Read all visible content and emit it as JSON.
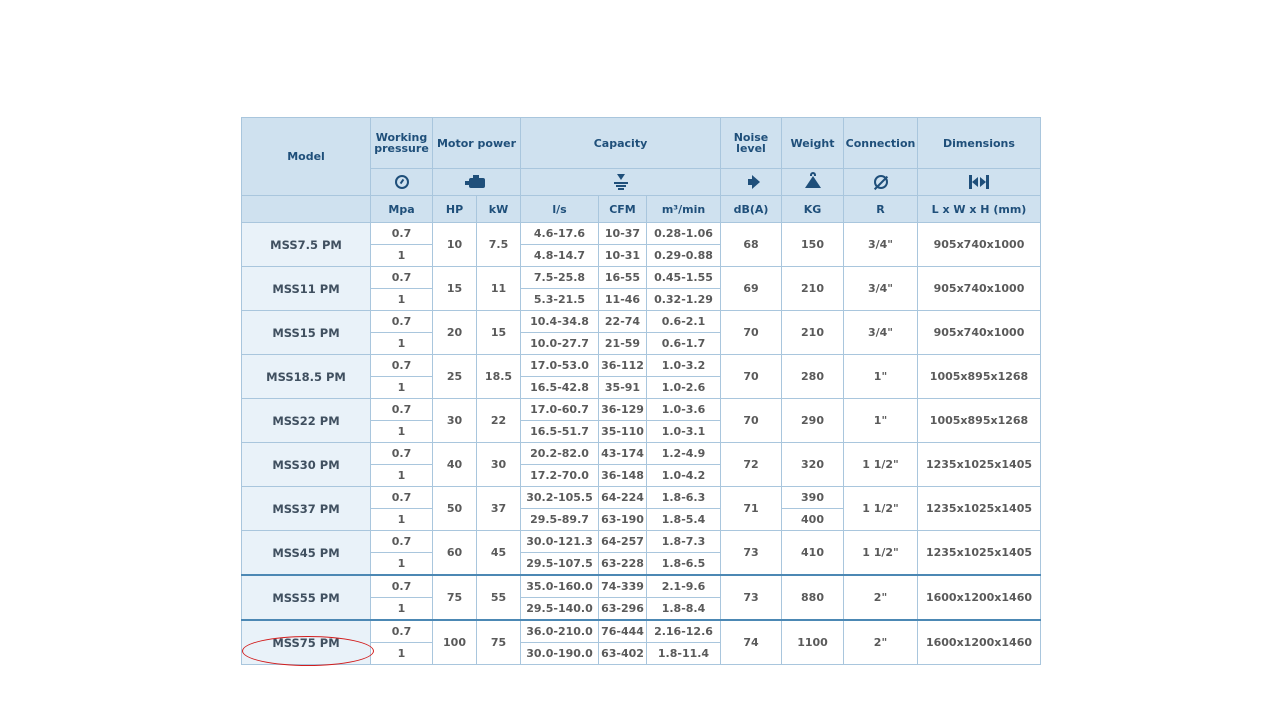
{
  "header": {
    "model": "Model",
    "working_pressure": "Working pressure",
    "motor_power": "Motor power",
    "capacity": "Capacity",
    "noise_level": "Noise level",
    "weight": "Weight",
    "connection": "Connection",
    "dimensions": "Dimensions",
    "units": {
      "pressure": "Mpa",
      "hp": "HP",
      "kw": "kW",
      "ls": "l/s",
      "cfm": "CFM",
      "m3min": "m³/min",
      "dba": "dB(A)",
      "kg": "KG",
      "r": "R",
      "dims": "L x W x H (mm)"
    }
  },
  "rows": [
    {
      "model": "MSS7.5 PM",
      "p1": "0.7",
      "p2": "1",
      "hp": "10",
      "kw": "7.5",
      "ls1": "4.6-17.6",
      "cfm1": "10-37",
      "m31": "0.28-1.06",
      "ls2": "4.8-14.7",
      "cfm2": "10-31",
      "m32": "0.29-0.88",
      "db": "68",
      "kg": "150",
      "r": "3/4\"",
      "dims": "905x740x1000"
    },
    {
      "model": "MSS11 PM",
      "p1": "0.7",
      "p2": "1",
      "hp": "15",
      "kw": "11",
      "ls1": "7.5-25.8",
      "cfm1": "16-55",
      "m31": "0.45-1.55",
      "ls2": "5.3-21.5",
      "cfm2": "11-46",
      "m32": "0.32-1.29",
      "db": "69",
      "kg": "210",
      "r": "3/4\"",
      "dims": "905x740x1000"
    },
    {
      "model": "MSS15 PM",
      "p1": "0.7",
      "p2": "1",
      "hp": "20",
      "kw": "15",
      "ls1": "10.4-34.8",
      "cfm1": "22-74",
      "m31": "0.6-2.1",
      "ls2": "10.0-27.7",
      "cfm2": "21-59",
      "m32": "0.6-1.7",
      "db": "70",
      "kg": "210",
      "r": "3/4\"",
      "dims": "905x740x1000"
    },
    {
      "model": "MSS18.5 PM",
      "p1": "0.7",
      "p2": "1",
      "hp": "25",
      "kw": "18.5",
      "ls1": "17.0-53.0",
      "cfm1": "36-112",
      "m31": "1.0-3.2",
      "ls2": "16.5-42.8",
      "cfm2": "35-91",
      "m32": "1.0-2.6",
      "db": "70",
      "kg": "280",
      "r": "1\"",
      "dims": "1005x895x1268"
    },
    {
      "model": "MSS22 PM",
      "p1": "0.7",
      "p2": "1",
      "hp": "30",
      "kw": "22",
      "ls1": "17.0-60.7",
      "cfm1": "36-129",
      "m31": "1.0-3.6",
      "ls2": "16.5-51.7",
      "cfm2": "35-110",
      "m32": "1.0-3.1",
      "db": "70",
      "kg": "290",
      "r": "1\"",
      "dims": "1005x895x1268"
    },
    {
      "model": "MSS30 PM",
      "p1": "0.7",
      "p2": "1",
      "hp": "40",
      "kw": "30",
      "ls1": "20.2-82.0",
      "cfm1": "43-174",
      "m31": "1.2-4.9",
      "ls2": "17.2-70.0",
      "cfm2": "36-148",
      "m32": "1.0-4.2",
      "db": "72",
      "kg": "320",
      "r": "1 1/2\"",
      "dims": "1235x1025x1405"
    },
    {
      "model": "MSS37 PM",
      "p1": "0.7",
      "p2": "1",
      "hp": "50",
      "kw": "37",
      "ls1": "30.2-105.5",
      "cfm1": "64-224",
      "m31": "1.8-6.3",
      "ls2": "29.5-89.7",
      "cfm2": "63-190",
      "m32": "1.8-5.4",
      "db": "71",
      "kg": "390",
      "kg2": "400",
      "r": "1 1/2\"",
      "dims": "1235x1025x1405"
    },
    {
      "model": "MSS45 PM",
      "p1": "0.7",
      "p2": "1",
      "hp": "60",
      "kw": "45",
      "ls1": "30.0-121.3",
      "cfm1": "64-257",
      "m31": "1.8-7.3",
      "ls2": "29.5-107.5",
      "cfm2": "63-228",
      "m32": "1.8-6.5",
      "db": "73",
      "kg": "410",
      "r": "1 1/2\"",
      "dims": "1235x1025x1405"
    },
    {
      "model": "MSS55 PM",
      "p1": "0.7",
      "p2": "1",
      "hp": "75",
      "kw": "55",
      "ls1": "35.0-160.0",
      "cfm1": "74-339",
      "m31": "2.1-9.6",
      "ls2": "29.5-140.0",
      "cfm2": "63-296",
      "m32": "1.8-8.4",
      "db": "73",
      "kg": "880",
      "r": "2\"",
      "dims": "1600x1200x1460"
    },
    {
      "model": "MSS75 PM",
      "p1": "0.7",
      "p2": "1",
      "hp": "100",
      "kw": "75",
      "ls1": "36.0-210.0",
      "cfm1": "76-444",
      "m31": "2.16-12.6",
      "ls2": "30.0-190.0",
      "cfm2": "63-402",
      "m32": "1.8-11.4",
      "db": "74",
      "kg": "1100",
      "r": "2\"",
      "dims": "1600x1200x1460"
    }
  ],
  "colors": {
    "header_bg": "#cfe1ef",
    "header_text": "#1f4f7a",
    "border": "#a9c6dd",
    "highlight": "#d21e1e"
  }
}
